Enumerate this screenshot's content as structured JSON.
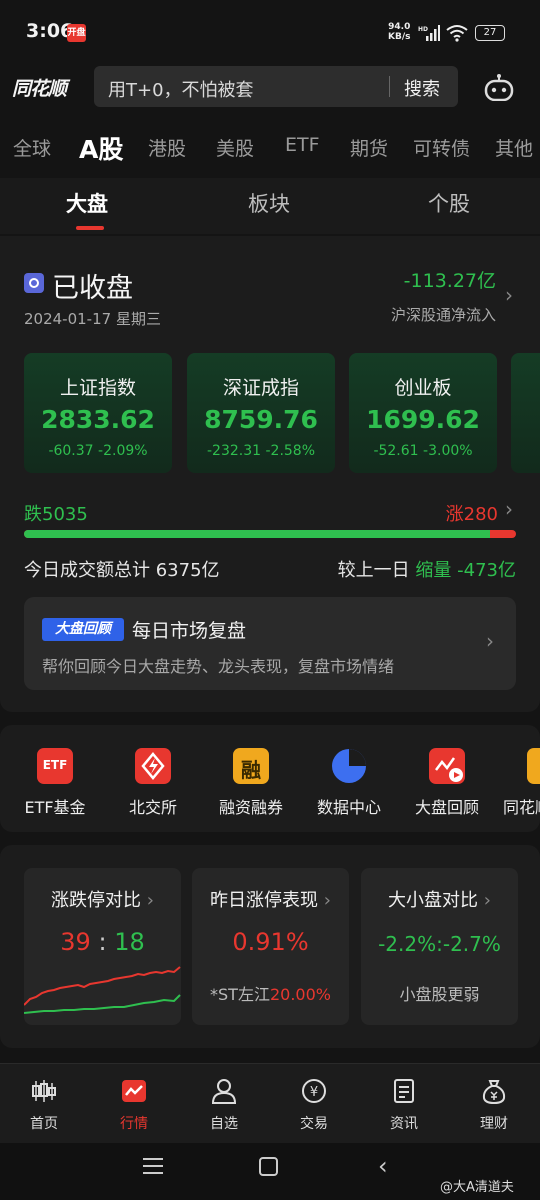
{
  "status_bar": {
    "time": "3:06",
    "badge": "开盘",
    "net_speed_value": "94.0",
    "net_speed_unit": "KB/s",
    "hd": "HD",
    "battery": "27"
  },
  "header": {
    "logo": "同花顺",
    "search_placeholder": "用T+0，不怕被套",
    "search_button": "搜索"
  },
  "market_tabs": [
    "全球",
    "A股",
    "港股",
    "美股",
    "ETF",
    "期货",
    "可转债",
    "其他"
  ],
  "market_tab_active": "A股",
  "sub_tabs": [
    "大盘",
    "板块",
    "个股"
  ],
  "sub_tab_active": "大盘",
  "market_status": {
    "title": "已收盘",
    "date": "2024-01-17 星期三",
    "net_inflow": "-113.27亿",
    "net_inflow_label": "沪深股通净流入"
  },
  "indices": [
    {
      "name": "上证指数",
      "value": "2833.62",
      "change": "-60.37",
      "pct": "-2.09%"
    },
    {
      "name": "深证成指",
      "value": "8759.76",
      "change": "-232.31",
      "pct": "-2.58%"
    },
    {
      "name": "创业板",
      "value": "1699.62",
      "change": "-52.61",
      "pct": "-3.00%"
    }
  ],
  "breadth": {
    "fall_label": "跌",
    "fall": "5035",
    "rise_label": "涨",
    "rise": "280",
    "fall_ratio": 0.947
  },
  "turnover": {
    "label": "今日成交额总计",
    "value": "6375亿",
    "compare_label": "较上一日",
    "compare_status": "缩量",
    "compare_value": "-473亿"
  },
  "review": {
    "badge": "大盘回顾",
    "title": "每日市场复盘",
    "desc": "帮你回顾今日大盘走势、龙头表现，复盘市场情绪"
  },
  "shortcuts": [
    {
      "label": "ETF基金",
      "icon": "etf-icon",
      "icon_text": "ETF"
    },
    {
      "label": "北交所",
      "icon": "bse-icon",
      "icon_text": ""
    },
    {
      "label": "融资融券",
      "icon": "margin-icon",
      "icon_text": "融"
    },
    {
      "label": "数据中心",
      "icon": "pie-chart-icon",
      "icon_text": ""
    },
    {
      "label": "大盘回顾",
      "icon": "review-play-icon",
      "icon_text": ""
    },
    {
      "label": "同花顺",
      "icon": "partial-icon",
      "icon_text": ""
    }
  ],
  "stats": {
    "limit": {
      "title": "涨跌停对比",
      "up": "39",
      "sep": ":",
      "down": "18"
    },
    "yesterday": {
      "title": "昨日涨停表现",
      "value": "0.91%",
      "stock": "*ST左江",
      "stock_pct": "20.00%"
    },
    "size": {
      "title": "大小盘对比",
      "value": "-2.2%:-2.7%",
      "desc": "小盘股更弱"
    }
  },
  "bottom_nav": [
    {
      "label": "首页",
      "icon": "candlestick-icon"
    },
    {
      "label": "行情",
      "icon": "market-chart-icon"
    },
    {
      "label": "自选",
      "icon": "user-icon"
    },
    {
      "label": "交易",
      "icon": "yuan-icon"
    },
    {
      "label": "资讯",
      "icon": "news-icon"
    },
    {
      "label": "理财",
      "icon": "money-bag-icon"
    }
  ],
  "bottom_nav_active": "行情",
  "watermark": "@大A清道夫",
  "colors": {
    "up": "#e8372f",
    "down": "#2fbf4f",
    "accent": "#e8372f",
    "background": "#141414"
  }
}
